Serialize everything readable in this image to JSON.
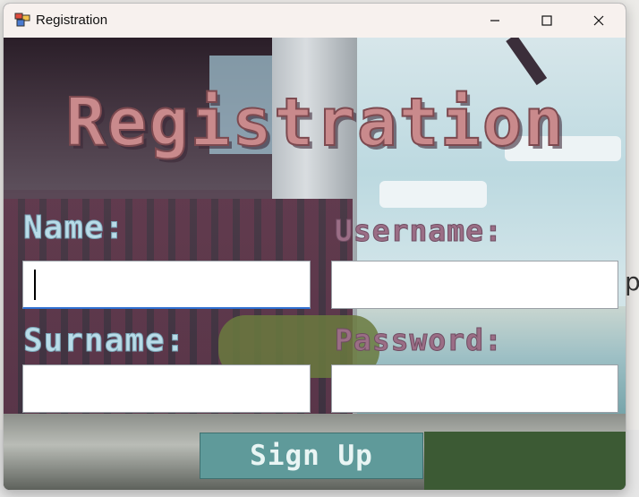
{
  "window": {
    "title": "Registration",
    "controls": {
      "minimize": "—",
      "maximize": "☐",
      "close": "✕"
    }
  },
  "form": {
    "heading": "Registration",
    "name_label": "Name:",
    "username_label": "Username:",
    "surname_label": "Surname:",
    "password_label": "Password:",
    "name_value": "",
    "username_value": "",
    "surname_value": "",
    "password_value": "",
    "signup_label": "Sign Up"
  },
  "background_partial_text": "p",
  "colors": {
    "title_fill": "#c98a8c",
    "label_light": "#b9dce8",
    "label_pink": "#9b6e86",
    "button_bg": "#5f9a9a",
    "focus_border": "#2f6fd1"
  },
  "icons": {
    "app": "app-icon"
  }
}
